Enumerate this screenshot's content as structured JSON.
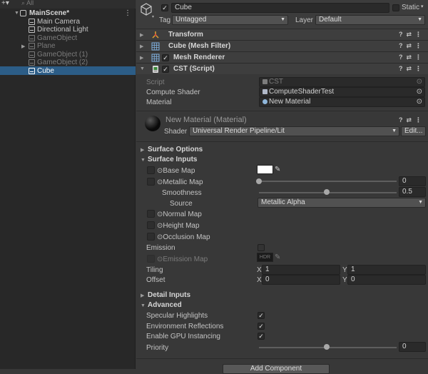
{
  "hierarchy": {
    "search_placeholder": "All",
    "scene": "MainScene*",
    "items": [
      {
        "label": "Main Camera",
        "disabled": false
      },
      {
        "label": "Directional Light",
        "disabled": false
      },
      {
        "label": "GameObject",
        "disabled": true
      },
      {
        "label": "Plane",
        "disabled": true
      },
      {
        "label": "GameObject (1)",
        "disabled": true
      },
      {
        "label": "GameObject (2)",
        "disabled": true
      },
      {
        "label": "Cube",
        "disabled": false,
        "selected": true
      }
    ]
  },
  "header": {
    "name": "Cube",
    "static_label": "Static",
    "tag_label": "Tag",
    "tag_value": "Untagged",
    "layer_label": "Layer",
    "layer_value": "Default"
  },
  "components": {
    "transform": "Transform",
    "mesh_filter": "Cube (Mesh Filter)",
    "mesh_renderer": "Mesh Renderer",
    "script": "CST (Script)"
  },
  "script_fields": {
    "script_label": "Script",
    "script_value": "CST",
    "compute_label": "Compute Shader",
    "compute_value": "ComputeShaderTest",
    "material_label": "Material",
    "material_value": "New Material"
  },
  "material": {
    "title": "New Material (Material)",
    "shader_label": "Shader",
    "shader_value": "Universal Render Pipeline/Lit",
    "edit_label": "Edit..."
  },
  "surface": {
    "options": "Surface Options",
    "inputs": "Surface Inputs",
    "base_map": "Base Map",
    "metallic_map": "Metallic Map",
    "metallic_value": "0",
    "smoothness": "Smoothness",
    "smoothness_value": "0.5",
    "smoothness_level": 0.5,
    "source": "Source",
    "source_value": "Metallic Alpha",
    "normal_map": "Normal Map",
    "height_map": "Height Map",
    "occlusion_map": "Occlusion Map",
    "emission": "Emission",
    "emission_map": "Emission Map",
    "hdr": "HDR",
    "tiling": "Tiling",
    "tiling_x": "1",
    "tiling_y": "1",
    "offset": "Offset",
    "offset_x": "0",
    "offset_y": "0",
    "x": "X",
    "y": "Y"
  },
  "detail": {
    "label": "Detail Inputs"
  },
  "advanced": {
    "label": "Advanced",
    "specular": "Specular Highlights",
    "env_reflections": "Environment Reflections",
    "gpu_instancing": "Enable GPU Instancing",
    "priority": "Priority",
    "priority_value": "0"
  },
  "footer": {
    "add_component": "Add Component"
  }
}
